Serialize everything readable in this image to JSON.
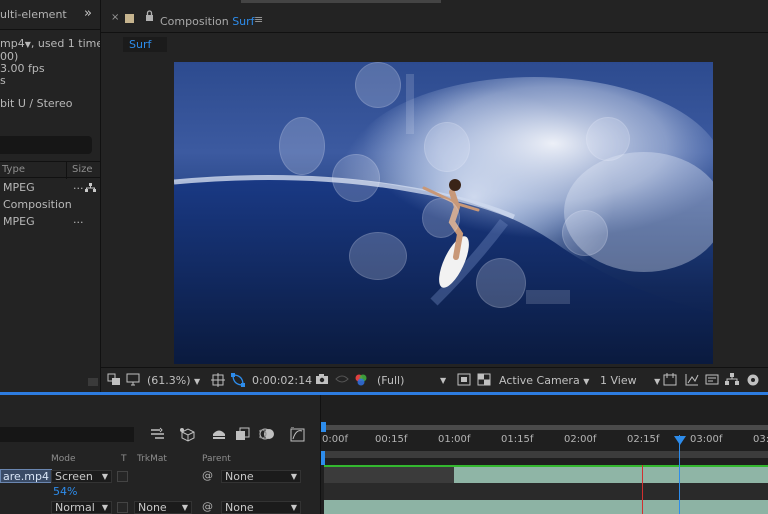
{
  "project": {
    "panel_title": "ulti-element",
    "expand_icon": "double-chevron-right-icon",
    "info_line1_prefix": "mp4",
    "info_line1_suffix": ", used 1 time",
    "info_line2": "00)",
    "info_line3": "3.00 fps",
    "info_line4": "s",
    "audio": "bit U / Stereo",
    "columns": {
      "type": "Type",
      "size": "Size"
    },
    "items": [
      {
        "type": "MPEG",
        "ellipsis": "...",
        "has_net_icon": true
      },
      {
        "type": "Composition",
        "ellipsis": "",
        "has_net_icon": false
      },
      {
        "type": "MPEG",
        "ellipsis": "...",
        "has_net_icon": false
      }
    ]
  },
  "comp": {
    "tab_close": "×",
    "tab_prefix": "Composition",
    "tab_name": "Surf",
    "tab_menu": "≡",
    "breadcrumb": "Surf",
    "swatch_color": "#c6b48e",
    "accent_color": "#2d8ceb",
    "toolbar": {
      "zoom": "(61.3%)",
      "timecode": "0:00:02:14",
      "resolution": "(Full)",
      "camera": "Active Camera",
      "views": "1 View"
    }
  },
  "timeline": {
    "columns": {
      "mode": "Mode",
      "t": "T",
      "trkmat": "TrkMat",
      "parent": "Parent"
    },
    "rows": [
      {
        "layer_name": "are.mp4",
        "mode": "Screen",
        "parent": "None"
      },
      {
        "opacity": "54%"
      },
      {
        "mode": "Normal",
        "trkmat": "None",
        "parent": "None"
      }
    ],
    "ruler": [
      "0:00f",
      "00:15f",
      "01:00f",
      "01:15f",
      "02:00f",
      "02:15f",
      "03:00f",
      "03:"
    ],
    "current_time_fraction": 0.8,
    "colors": {
      "layer_bar": "#8fb5a6",
      "green_line": "#33b82f",
      "playhead": "#2d8ceb",
      "out_point": "#d03030"
    }
  }
}
